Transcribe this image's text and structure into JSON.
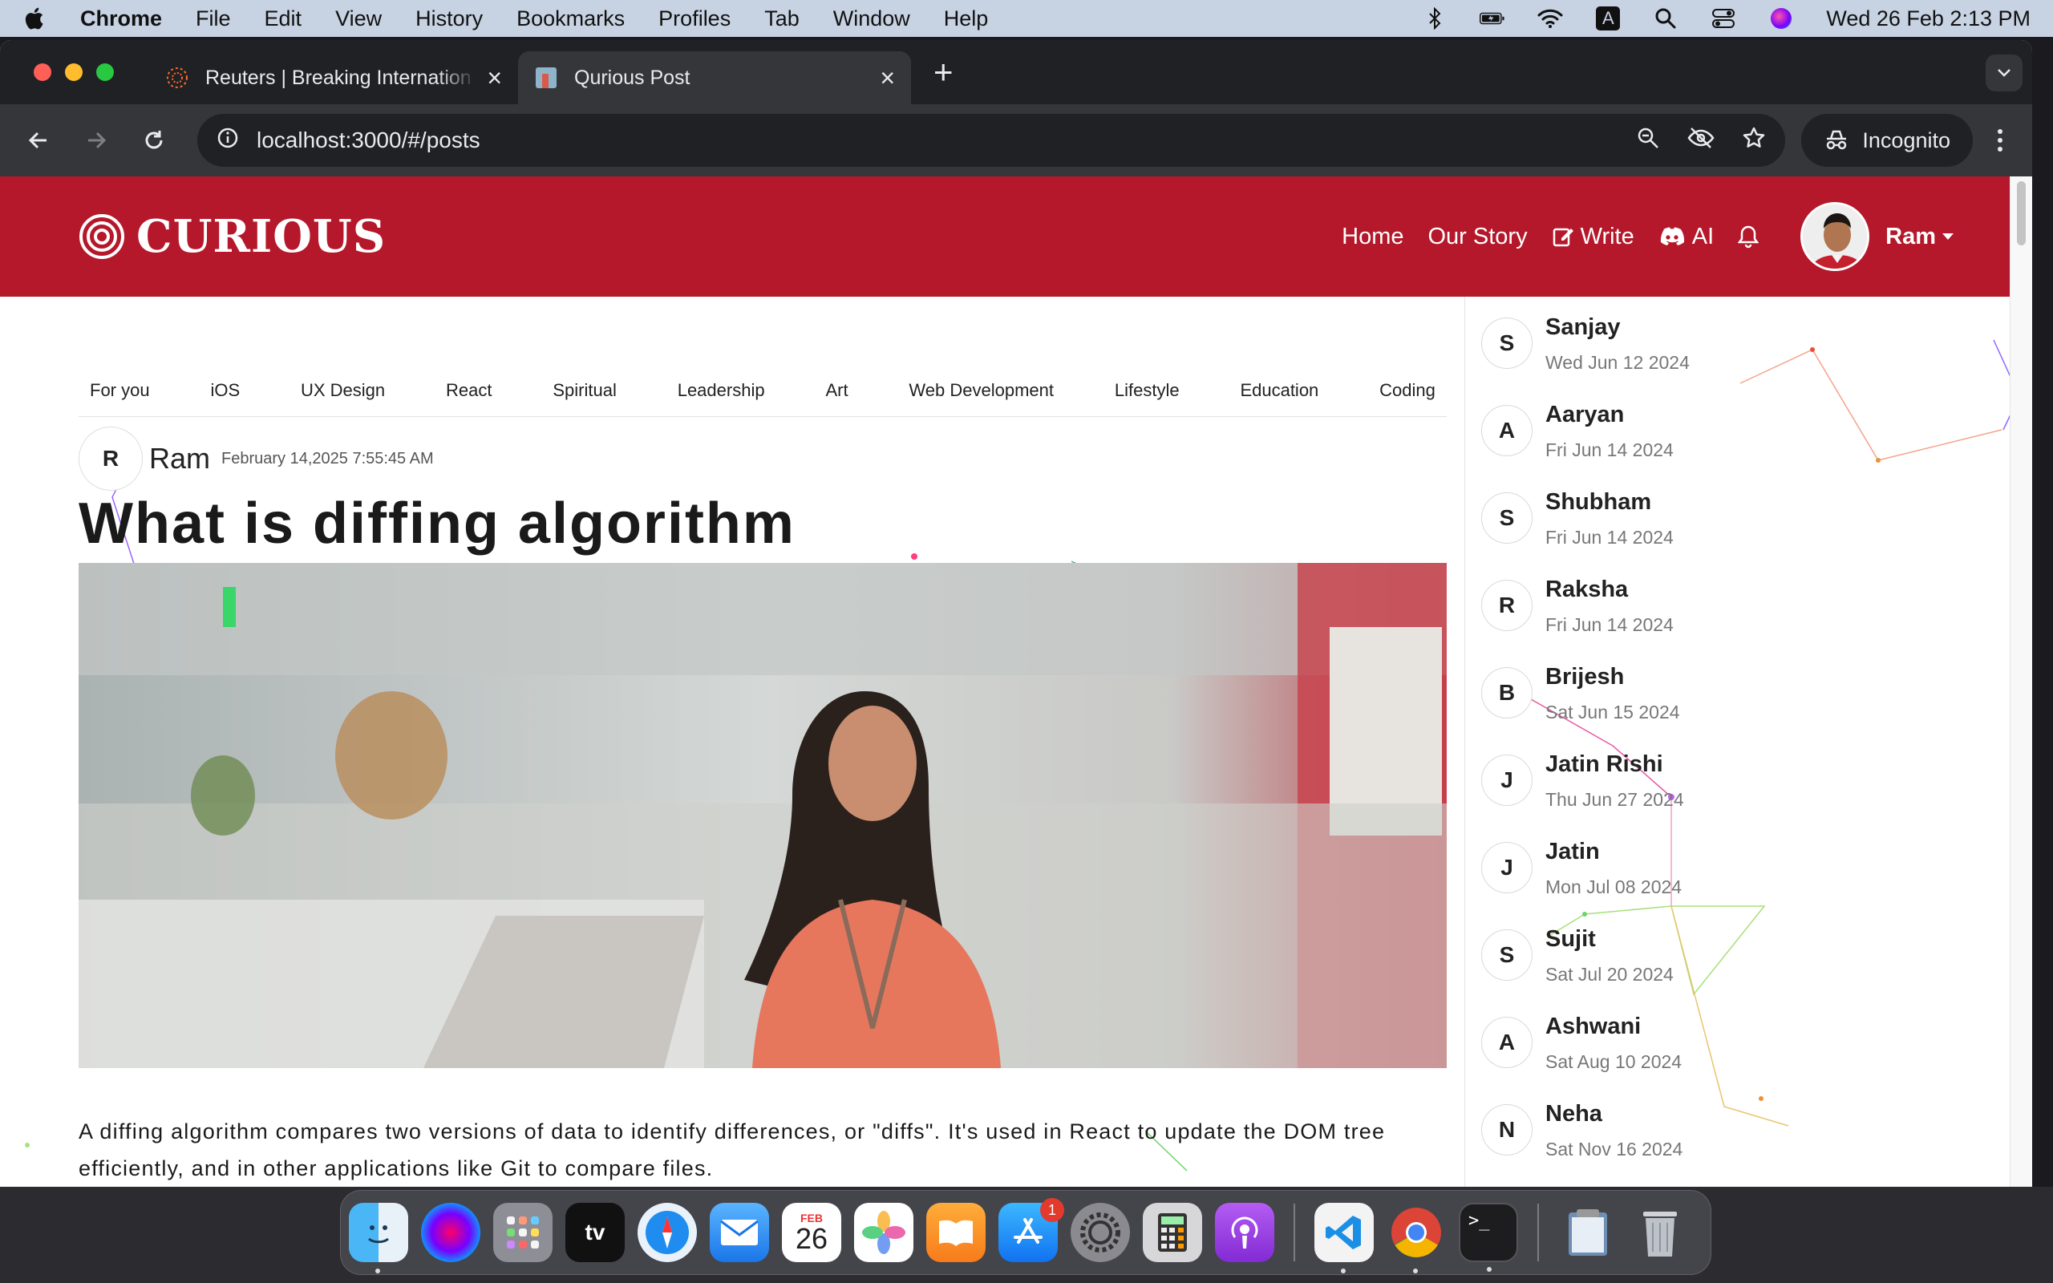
{
  "menubar": {
    "app_name": "Chrome",
    "items": [
      "File",
      "Edit",
      "View",
      "History",
      "Bookmarks",
      "Profiles",
      "Tab",
      "Window",
      "Help"
    ],
    "clock": "Wed 26 Feb  2:13 PM",
    "input_source": "A"
  },
  "browser": {
    "tabs": [
      {
        "title": "Reuters | Breaking Internation",
        "active": false
      },
      {
        "title": "Qurious Post",
        "active": true
      }
    ],
    "url": "localhost:3000/#/posts",
    "incognito_label": "Incognito"
  },
  "site": {
    "brand": "CURIOUS",
    "nav": {
      "home": "Home",
      "our_story": "Our Story",
      "write": "Write",
      "ai": "AI",
      "user": "Ram"
    },
    "accent_color": "#b5182a"
  },
  "categories": [
    "For you",
    "iOS",
    "UX Design",
    "React",
    "Spiritual",
    "Leadership",
    "Art",
    "Web Development",
    "Lifestyle",
    "Education",
    "Coding"
  ],
  "post": {
    "author_initial": "R",
    "author": "Ram",
    "date": "February 14,2025 7:55:45 AM",
    "title": "What is diffing algorithm",
    "body": "A diffing algorithm compares two versions of data to identify differences, or \"diffs\". It's used in React to update the DOM tree efficiently, and in other applications like Git to compare files."
  },
  "sidebar": {
    "users": [
      {
        "initial": "S",
        "name": "Sanjay",
        "date": "Wed Jun 12 2024"
      },
      {
        "initial": "A",
        "name": "Aaryan",
        "date": "Fri Jun 14 2024"
      },
      {
        "initial": "S",
        "name": "Shubham",
        "date": "Fri Jun 14 2024"
      },
      {
        "initial": "R",
        "name": "Raksha",
        "date": "Fri Jun 14 2024"
      },
      {
        "initial": "B",
        "name": "Brijesh",
        "date": "Sat Jun 15 2024"
      },
      {
        "initial": "J",
        "name": "Jatin Rishi",
        "date": "Thu Jun 27 2024"
      },
      {
        "initial": "J",
        "name": "Jatin",
        "date": "Mon Jul 08 2024"
      },
      {
        "initial": "S",
        "name": "Sujit",
        "date": "Sat Jul 20 2024"
      },
      {
        "initial": "A",
        "name": "Ashwani",
        "date": "Sat Aug 10 2024"
      },
      {
        "initial": "N",
        "name": "Neha",
        "date": "Sat Nov 16 2024"
      }
    ]
  },
  "dock": {
    "apps": [
      "finder-icon",
      "siri-icon",
      "launchpad-icon",
      "apple-tv-icon",
      "safari-icon",
      "mail-icon",
      "calendar-icon",
      "photos-icon",
      "books-icon",
      "app-store-icon",
      "system-settings-icon",
      "calculator-icon",
      "podcasts-icon",
      "vscode-icon",
      "chrome-icon",
      "terminal-icon",
      "preview-icon",
      "trash-icon"
    ],
    "calendar_month": "FEB",
    "calendar_day": "26",
    "appstore_badge": "1",
    "tv_label": "tv"
  }
}
